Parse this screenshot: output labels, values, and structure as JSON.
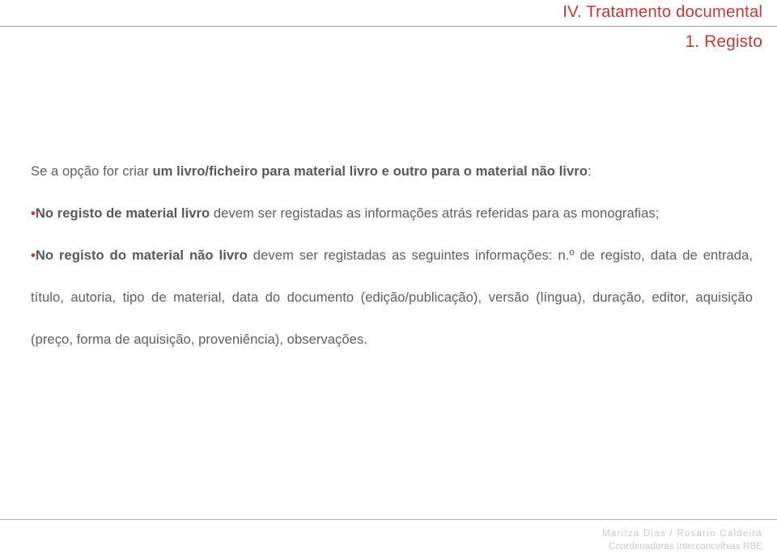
{
  "slide": {
    "header": {
      "title": "IV. Tratamento documental",
      "subtitle": "1. Registo",
      "accent_color": "#B93E37",
      "rule_color": "#9E9E9E"
    },
    "body": {
      "text_color": "#5E5E5E",
      "bullet_glyph": "•",
      "bullet_color": "#B93E37",
      "paragraphs": [
        {
          "id": "intro",
          "bulleted": false,
          "runs": [
            {
              "text": "Se a opção for criar ",
              "bold": false
            },
            {
              "text": "um livro/ficheiro para material livro e outro para o material não livro",
              "bold": true
            },
            {
              "text": ":",
              "bold": false
            }
          ]
        },
        {
          "id": "material-livro",
          "bulleted": true,
          "runs": [
            {
              "text": "No registo de material livro",
              "bold": true
            },
            {
              "text": " devem ser registadas as informações atrás referidas para as monografias;",
              "bold": false
            }
          ]
        },
        {
          "id": "material-nao-livro",
          "bulleted": true,
          "runs": [
            {
              "text": "No registo do material não livro",
              "bold": true
            },
            {
              "text": " devem ser registadas as seguintes informações:  n.º de registo, data de entrada, título, autoria, tipo de material, data do documento (edição/publicação), versão (língua), duração, editor, aquisição (preço, forma de aquisição, proveniência), observações.",
              "bold": false
            }
          ]
        }
      ]
    },
    "footer": {
      "authors": "Maritza Dias / Rosário Caldeira",
      "role": "Coordenadoras Interconcelhias RBE",
      "rule_color": "#B5B5B5",
      "text_color": "#C9C9C9"
    }
  }
}
